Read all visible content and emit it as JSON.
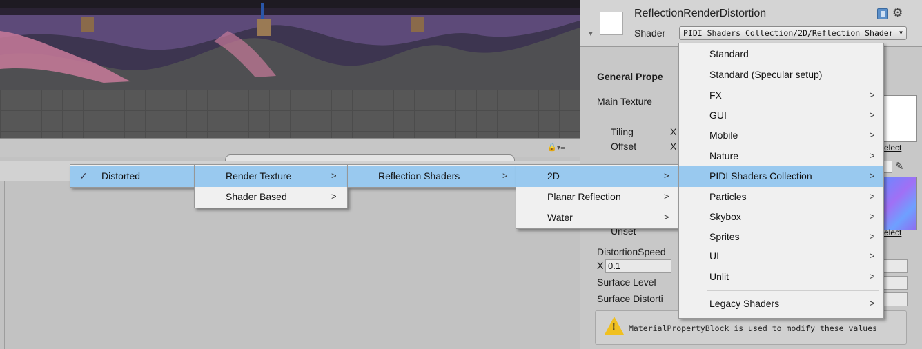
{
  "inspector": {
    "material_name": "ReflectionRenderDistortion",
    "shader_label": "Shader",
    "shader_value": "PIDI Shaders Collection/2D/Reflection Shader",
    "section_title": "General Prope",
    "main_texture_label": "Main Texture",
    "tiling_label": "Tiling",
    "offset_label": "Offset",
    "x_label": "X",
    "select_label": "elect",
    "offset2_label": "Unset",
    "distortion_speed_label": "DistortionSpeed",
    "distortion_x_value": "0.1",
    "surface_level_label": "Surface Level",
    "surface_distortion_label": "Surface Distorti",
    "warning_text": "MaterialPropertyBlock is used to modify these values",
    "icons": [
      "help-icon",
      "gear-icon",
      "eyedropper-icon",
      "warning-icon",
      "foldout-arrow-icon"
    ]
  },
  "menus": {
    "level1": [
      {
        "label": "Distorted",
        "checked": true,
        "highlighted": true
      }
    ],
    "level2": [
      {
        "label": "Render Texture",
        "has_submenu": true,
        "highlighted": true
      },
      {
        "label": "Shader Based",
        "has_submenu": true,
        "highlighted": false
      }
    ],
    "level3": [
      {
        "label": "Reflection Shaders",
        "has_submenu": true,
        "highlighted": true
      }
    ],
    "level4": [
      {
        "label": "2D",
        "has_submenu": true,
        "highlighted": true
      },
      {
        "label": "Planar Reflection",
        "has_submenu": true,
        "highlighted": false
      },
      {
        "label": "Water",
        "has_submenu": true,
        "highlighted": false
      }
    ],
    "shader_menu": [
      {
        "label": "Standard",
        "has_submenu": false,
        "highlighted": false
      },
      {
        "label": "Standard (Specular setup)",
        "has_submenu": false,
        "highlighted": false
      },
      {
        "label": "FX",
        "has_submenu": true,
        "highlighted": false
      },
      {
        "label": "GUI",
        "has_submenu": true,
        "highlighted": false
      },
      {
        "label": "Mobile",
        "has_submenu": true,
        "highlighted": false
      },
      {
        "label": "Nature",
        "has_submenu": true,
        "highlighted": false
      },
      {
        "label": "PIDI Shaders Collection",
        "has_submenu": true,
        "highlighted": true
      },
      {
        "label": "Particles",
        "has_submenu": true,
        "highlighted": false
      },
      {
        "label": "Skybox",
        "has_submenu": true,
        "highlighted": false
      },
      {
        "label": "Sprites",
        "has_submenu": true,
        "highlighted": false
      },
      {
        "label": "UI",
        "has_submenu": true,
        "highlighted": false
      },
      {
        "label": "Unlit",
        "has_submenu": true,
        "highlighted": false
      },
      {
        "label": "Legacy Shaders",
        "has_submenu": true,
        "highlighted": false
      }
    ],
    "arrow_glyph": ">",
    "check_glyph": "✓"
  },
  "colors": {
    "menu_highlight": "#99c9ef",
    "menu_background": "#f0f0f0",
    "inspector_background": "#c8c8c8",
    "scene_background": "#4e4e4e"
  }
}
